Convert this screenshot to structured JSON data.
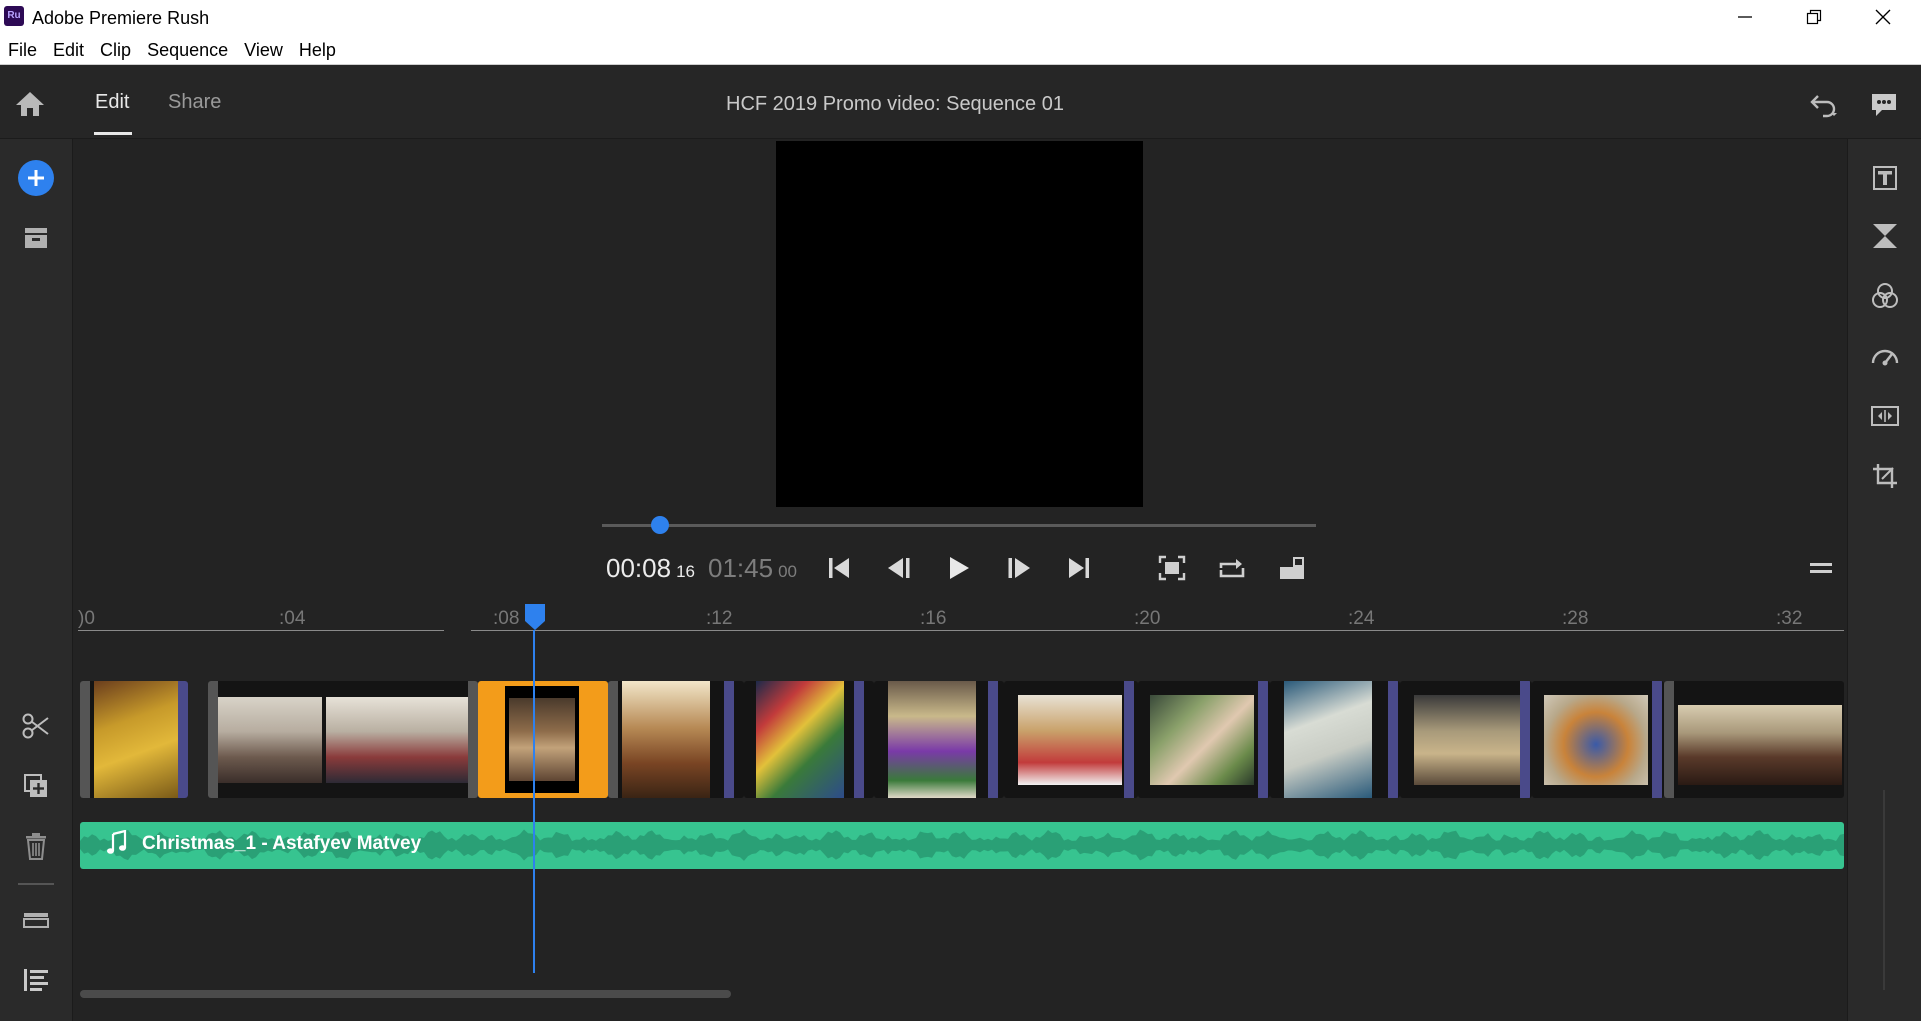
{
  "window": {
    "title": "Adobe Premiere Rush",
    "logo_text": "Ru"
  },
  "menu": [
    "File",
    "Edit",
    "Clip",
    "Sequence",
    "View",
    "Help"
  ],
  "header": {
    "tabs": [
      {
        "label": "Edit",
        "active": true
      },
      {
        "label": "Share",
        "active": false
      }
    ],
    "project_title": "HCF 2019 Promo video: Sequence 01"
  },
  "player": {
    "current_time": "00:08",
    "current_frames": "16",
    "duration": "01:45",
    "duration_frames": "00",
    "scrub_fraction": 0.081
  },
  "timeline": {
    "ruler_labels": [
      ")0",
      ":04",
      ":08",
      ":12",
      ":16",
      ":20",
      ":24",
      ":28",
      ":32"
    ],
    "audio_clip_title": "Christmas_1 - Astafyev Matvey"
  },
  "colors": {
    "accent": "#2e81ee",
    "selected_clip": "#f39c1a",
    "audio_track": "#37c490",
    "clip_separator": "#4a4a8a",
    "background": "#232323"
  },
  "icons": {
    "left_rail": [
      "home-icon",
      "add-media-icon",
      "project-assets-icon",
      "split-icon",
      "duplicate-icon",
      "delete-icon",
      "track-options-icon",
      "track-list-icon"
    ],
    "right_rail": [
      "titles-icon",
      "transitions-icon",
      "color-icon",
      "speed-icon",
      "audio-icon",
      "transform-icon"
    ],
    "header_right": [
      "undo-icon",
      "feedback-icon"
    ],
    "player": [
      "go-to-start-icon",
      "step-back-icon",
      "play-icon",
      "step-forward-icon",
      "go-to-end-icon",
      "fit-icon",
      "loop-icon",
      "aspect-ratio-icon",
      "menu-icon"
    ]
  }
}
